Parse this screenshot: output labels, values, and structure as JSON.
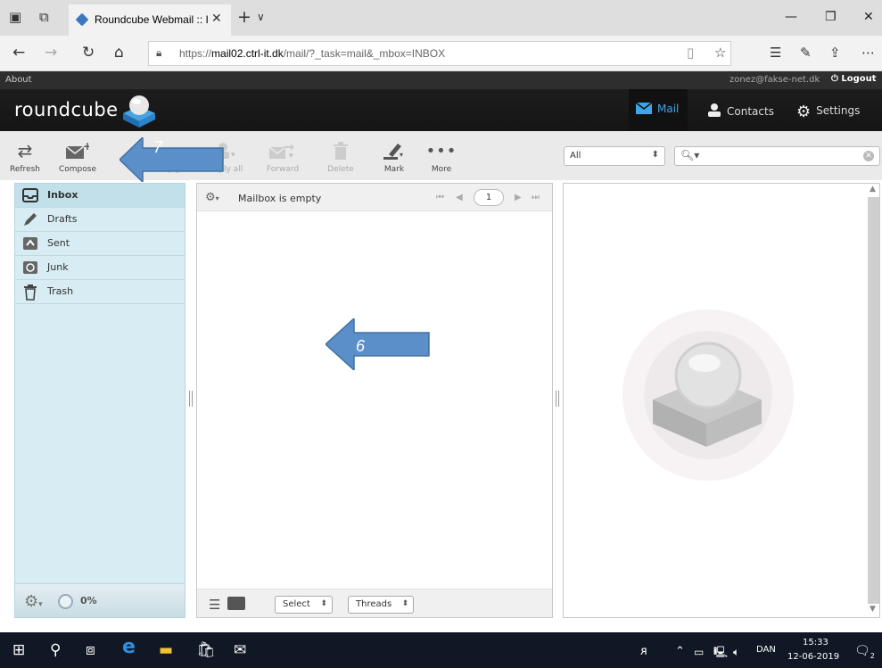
{
  "browser": {
    "tab_title": "Roundcube Webmail :: I",
    "url_prefix": "https://",
    "url_domain": "mail02.ctrl-it.dk",
    "url_path": "/mail/?_task=mail&_mbox=INBOX"
  },
  "topline": {
    "about": "About",
    "user": "zonez@fakse-net.dk",
    "logout": "Logout"
  },
  "header": {
    "logo": "roundcube",
    "tasks": {
      "mail": "Mail",
      "contacts": "Contacts",
      "settings": "Settings"
    }
  },
  "toolbar": {
    "refresh": "Refresh",
    "compose": "Compose",
    "reply": "Reply",
    "reply_all": "Reply all",
    "forward": "Forward",
    "delete": "Delete",
    "mark": "Mark",
    "more": "More"
  },
  "search": {
    "filter": "All"
  },
  "folders": [
    {
      "name": "Inbox",
      "icon": "inbox-icon",
      "selected": true
    },
    {
      "name": "Drafts",
      "icon": "pencil-icon"
    },
    {
      "name": "Sent",
      "icon": "sent-icon"
    },
    {
      "name": "Junk",
      "icon": "junk-icon"
    },
    {
      "name": "Trash",
      "icon": "trash-icon"
    }
  ],
  "quota": "0%",
  "message_list": {
    "status": "Mailbox is empty",
    "page": "1",
    "select_label": "Select",
    "threads_label": "Threads"
  },
  "annotations": {
    "arrow_left": "7",
    "arrow_center": "6"
  },
  "taskbar": {
    "lang": "DAN",
    "time": "15:33",
    "date": "12-06-2019",
    "notif_count": "2"
  },
  "colors": {
    "accent": "#3ca6e8",
    "folder_bg": "#d7ecf3",
    "arrow_fill": "#5b8fc9"
  }
}
